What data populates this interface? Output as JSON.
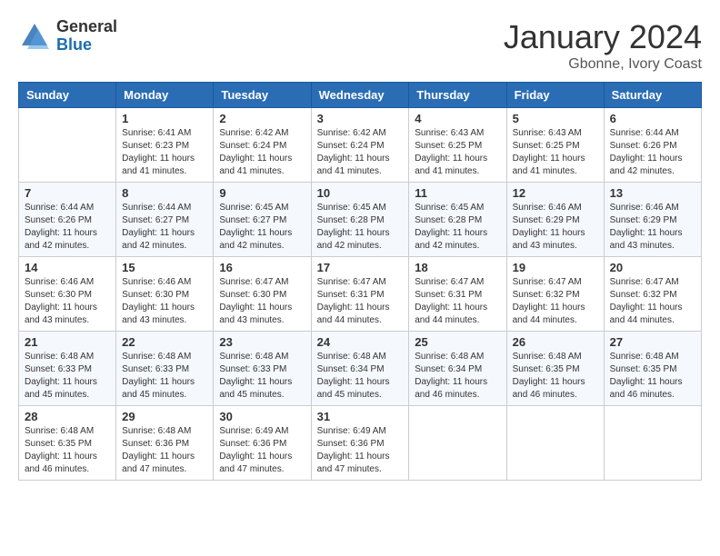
{
  "header": {
    "logo_general": "General",
    "logo_blue": "Blue",
    "month_title": "January 2024",
    "location": "Gbonne, Ivory Coast"
  },
  "weekdays": [
    "Sunday",
    "Monday",
    "Tuesday",
    "Wednesday",
    "Thursday",
    "Friday",
    "Saturday"
  ],
  "weeks": [
    [
      {
        "day": "",
        "info": ""
      },
      {
        "day": "1",
        "info": "Sunrise: 6:41 AM\nSunset: 6:23 PM\nDaylight: 11 hours\nand 41 minutes."
      },
      {
        "day": "2",
        "info": "Sunrise: 6:42 AM\nSunset: 6:24 PM\nDaylight: 11 hours\nand 41 minutes."
      },
      {
        "day": "3",
        "info": "Sunrise: 6:42 AM\nSunset: 6:24 PM\nDaylight: 11 hours\nand 41 minutes."
      },
      {
        "day": "4",
        "info": "Sunrise: 6:43 AM\nSunset: 6:25 PM\nDaylight: 11 hours\nand 41 minutes."
      },
      {
        "day": "5",
        "info": "Sunrise: 6:43 AM\nSunset: 6:25 PM\nDaylight: 11 hours\nand 41 minutes."
      },
      {
        "day": "6",
        "info": "Sunrise: 6:44 AM\nSunset: 6:26 PM\nDaylight: 11 hours\nand 42 minutes."
      }
    ],
    [
      {
        "day": "7",
        "info": "Sunrise: 6:44 AM\nSunset: 6:26 PM\nDaylight: 11 hours\nand 42 minutes."
      },
      {
        "day": "8",
        "info": "Sunrise: 6:44 AM\nSunset: 6:27 PM\nDaylight: 11 hours\nand 42 minutes."
      },
      {
        "day": "9",
        "info": "Sunrise: 6:45 AM\nSunset: 6:27 PM\nDaylight: 11 hours\nand 42 minutes."
      },
      {
        "day": "10",
        "info": "Sunrise: 6:45 AM\nSunset: 6:28 PM\nDaylight: 11 hours\nand 42 minutes."
      },
      {
        "day": "11",
        "info": "Sunrise: 6:45 AM\nSunset: 6:28 PM\nDaylight: 11 hours\nand 42 minutes."
      },
      {
        "day": "12",
        "info": "Sunrise: 6:46 AM\nSunset: 6:29 PM\nDaylight: 11 hours\nand 43 minutes."
      },
      {
        "day": "13",
        "info": "Sunrise: 6:46 AM\nSunset: 6:29 PM\nDaylight: 11 hours\nand 43 minutes."
      }
    ],
    [
      {
        "day": "14",
        "info": "Sunrise: 6:46 AM\nSunset: 6:30 PM\nDaylight: 11 hours\nand 43 minutes."
      },
      {
        "day": "15",
        "info": "Sunrise: 6:46 AM\nSunset: 6:30 PM\nDaylight: 11 hours\nand 43 minutes."
      },
      {
        "day": "16",
        "info": "Sunrise: 6:47 AM\nSunset: 6:30 PM\nDaylight: 11 hours\nand 43 minutes."
      },
      {
        "day": "17",
        "info": "Sunrise: 6:47 AM\nSunset: 6:31 PM\nDaylight: 11 hours\nand 44 minutes."
      },
      {
        "day": "18",
        "info": "Sunrise: 6:47 AM\nSunset: 6:31 PM\nDaylight: 11 hours\nand 44 minutes."
      },
      {
        "day": "19",
        "info": "Sunrise: 6:47 AM\nSunset: 6:32 PM\nDaylight: 11 hours\nand 44 minutes."
      },
      {
        "day": "20",
        "info": "Sunrise: 6:47 AM\nSunset: 6:32 PM\nDaylight: 11 hours\nand 44 minutes."
      }
    ],
    [
      {
        "day": "21",
        "info": "Sunrise: 6:48 AM\nSunset: 6:33 PM\nDaylight: 11 hours\nand 45 minutes."
      },
      {
        "day": "22",
        "info": "Sunrise: 6:48 AM\nSunset: 6:33 PM\nDaylight: 11 hours\nand 45 minutes."
      },
      {
        "day": "23",
        "info": "Sunrise: 6:48 AM\nSunset: 6:33 PM\nDaylight: 11 hours\nand 45 minutes."
      },
      {
        "day": "24",
        "info": "Sunrise: 6:48 AM\nSunset: 6:34 PM\nDaylight: 11 hours\nand 45 minutes."
      },
      {
        "day": "25",
        "info": "Sunrise: 6:48 AM\nSunset: 6:34 PM\nDaylight: 11 hours\nand 46 minutes."
      },
      {
        "day": "26",
        "info": "Sunrise: 6:48 AM\nSunset: 6:35 PM\nDaylight: 11 hours\nand 46 minutes."
      },
      {
        "day": "27",
        "info": "Sunrise: 6:48 AM\nSunset: 6:35 PM\nDaylight: 11 hours\nand 46 minutes."
      }
    ],
    [
      {
        "day": "28",
        "info": "Sunrise: 6:48 AM\nSunset: 6:35 PM\nDaylight: 11 hours\nand 46 minutes."
      },
      {
        "day": "29",
        "info": "Sunrise: 6:48 AM\nSunset: 6:36 PM\nDaylight: 11 hours\nand 47 minutes."
      },
      {
        "day": "30",
        "info": "Sunrise: 6:49 AM\nSunset: 6:36 PM\nDaylight: 11 hours\nand 47 minutes."
      },
      {
        "day": "31",
        "info": "Sunrise: 6:49 AM\nSunset: 6:36 PM\nDaylight: 11 hours\nand 47 minutes."
      },
      {
        "day": "",
        "info": ""
      },
      {
        "day": "",
        "info": ""
      },
      {
        "day": "",
        "info": ""
      }
    ]
  ]
}
